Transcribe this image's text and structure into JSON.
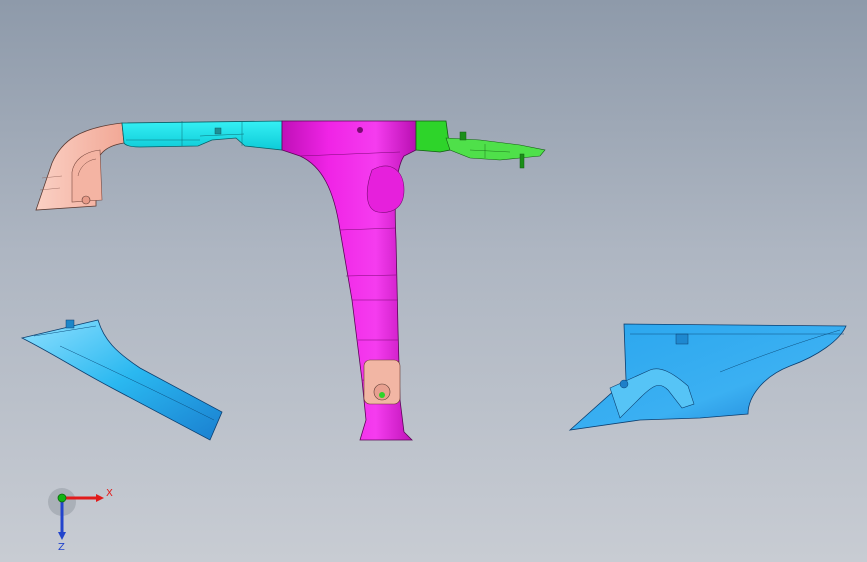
{
  "viewport": {
    "background_top": "#8e9aaa",
    "background_bottom": "#c8ccd3"
  },
  "parts": [
    {
      "name": "rear-quarter-trim-salmon",
      "color": "#f6b7a6"
    },
    {
      "name": "roof-rail-trim-cyan",
      "color": "#19e7ef"
    },
    {
      "name": "b-pillar-trim-magenta",
      "color": "#f21ee6"
    },
    {
      "name": "clip-bracket-green",
      "color": "#2ed42a"
    },
    {
      "name": "a-pillar-trim-blue",
      "color": "#27b8ee"
    },
    {
      "name": "rear-side-panel-blue",
      "color": "#2a9fe8"
    }
  ],
  "triad": {
    "x_label": "X",
    "z_label": "Z",
    "x_color": "#e11b1b",
    "y_color": "#12b312",
    "z_color": "#2244cc"
  }
}
